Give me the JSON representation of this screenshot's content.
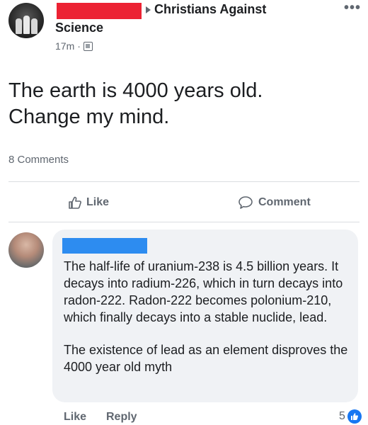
{
  "post": {
    "group_name": "Christians Against",
    "group_name_line2": "Science",
    "time": "17m",
    "text_line1": "The earth is 4000 years old.",
    "text_line2": "Change my mind.",
    "comment_count": "8 Comments"
  },
  "actions": {
    "like": "Like",
    "comment": "Comment"
  },
  "comment": {
    "paragraph1": "The half-life of uranium-238 is 4.5 billion years. It decays into radium-226, which in turn decays into radon-222. Radon-222 becomes polonium-210, which finally decays into a stable nuclide, lead.",
    "paragraph2": "The existence of lead as an element disproves the 4000 year old myth",
    "like": "Like",
    "reply": "Reply",
    "reaction_count": "5"
  },
  "colors": {
    "redaction_top": "#ec2233",
    "redaction_comment": "#2d8cf0",
    "like_badge": "#1877f2"
  },
  "icons": {
    "audience": "group-privacy-icon",
    "more": "more-options-icon",
    "like": "thumbs-up-icon",
    "comment": "speech-bubble-icon",
    "reaction": "like-reaction-icon"
  }
}
